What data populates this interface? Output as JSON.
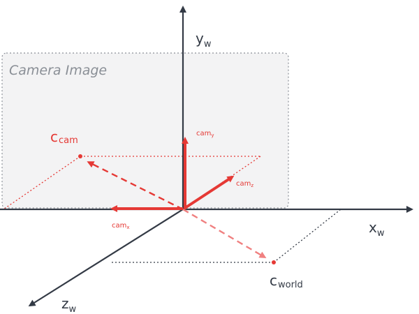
{
  "camera_image": {
    "label": "Camera Image"
  },
  "world_axes": {
    "x": {
      "base": "x",
      "sub": "w"
    },
    "y": {
      "base": "y",
      "sub": "w"
    },
    "z": {
      "base": "z",
      "sub": "w"
    }
  },
  "camera_axes": {
    "x": {
      "base": "cam",
      "sub": "x"
    },
    "y": {
      "base": "cam",
      "sub": "y"
    },
    "z": {
      "base": "cam",
      "sub": "z"
    }
  },
  "points": {
    "c_cam": {
      "base": "c",
      "sub": "cam"
    },
    "c_world": {
      "base": "c",
      "sub": "world"
    }
  },
  "colors": {
    "axis": "#333a45",
    "camera": "#e53935",
    "camera_light": "#f08080",
    "panel": "#f3f3f4",
    "panel_border": "#8a8f96"
  }
}
